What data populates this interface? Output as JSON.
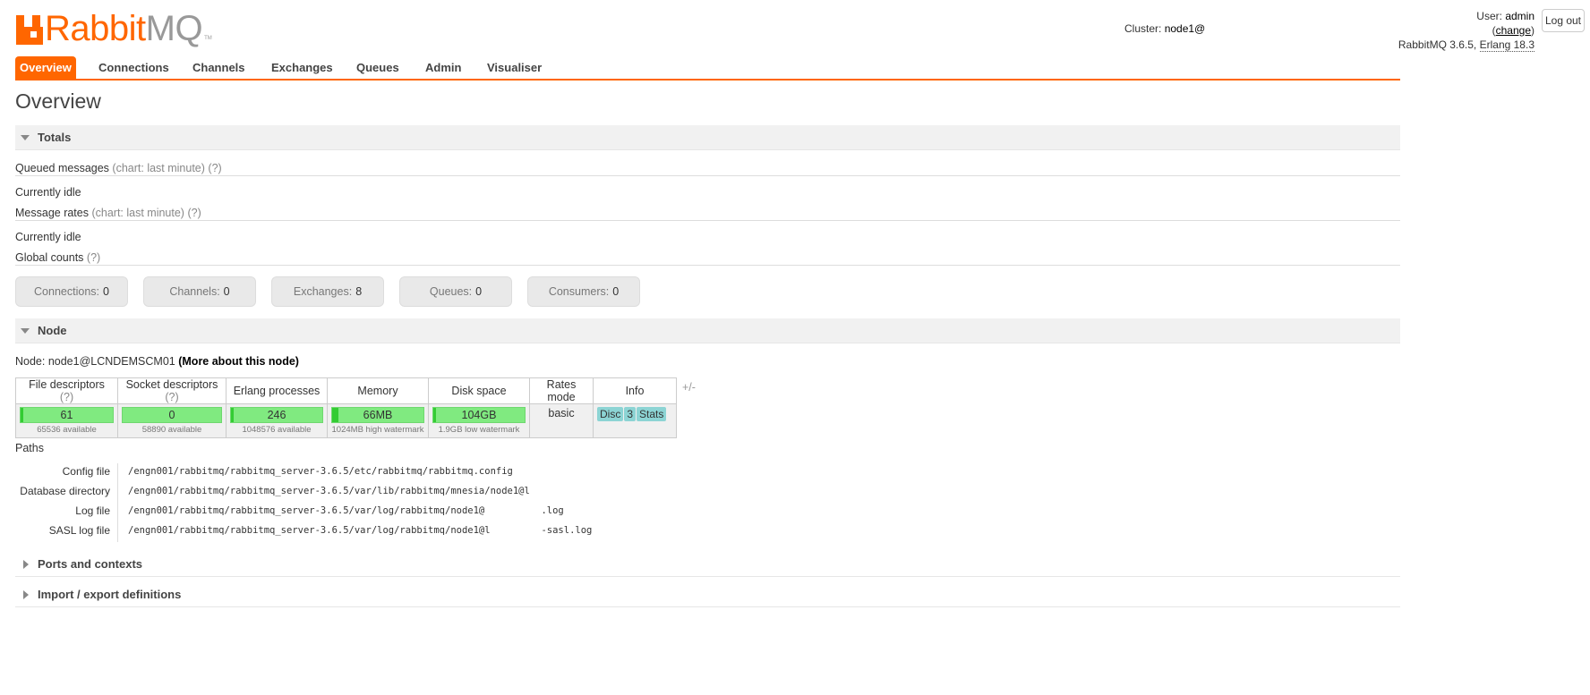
{
  "header": {
    "logo_rabbit": "Rabbit",
    "logo_mq": "MQ",
    "logo_tm": "TM",
    "cluster_label": "Cluster:",
    "cluster_value": "node1@",
    "user_label": "User:",
    "user_value": "admin",
    "change_open": "(",
    "change_link": "change",
    "change_close": ")",
    "version": "RabbitMQ 3.6.5,",
    "erlang": "Erlang 18.3",
    "logout": "Log out"
  },
  "tabs": [
    "Overview",
    "Connections",
    "Channels",
    "Exchanges",
    "Queues",
    "Admin",
    "Visualiser"
  ],
  "page_title": "Overview",
  "totals": {
    "header": "Totals",
    "queued_label": "Queued messages",
    "queued_chart": "(chart: last minute)",
    "help": "(?)",
    "queued_status": "Currently idle",
    "rates_label": "Message rates",
    "rates_chart": "(chart: last minute)",
    "rates_status": "Currently idle",
    "global_label": "Global counts",
    "counts": [
      {
        "label": "Connections:",
        "value": "0"
      },
      {
        "label": "Channels:",
        "value": "0"
      },
      {
        "label": "Exchanges:",
        "value": "8"
      },
      {
        "label": "Queues:",
        "value": "0"
      },
      {
        "label": "Consumers:",
        "value": "0"
      }
    ]
  },
  "node": {
    "header": "Node",
    "node_label": "Node: node1@LCNDEMSCM01",
    "more_link": "(More about this node)",
    "columns": {
      "fd": "File descriptors",
      "sd": "Socket descriptors",
      "ep": "Erlang processes",
      "mem": "Memory",
      "disk": "Disk space",
      "rates": "Rates mode",
      "info": "Info"
    },
    "help": "(?)",
    "fd_value": "61",
    "fd_sub": "65536 available",
    "fd_fraction": 0.001,
    "sd_value": "0",
    "sd_sub": "58890 available",
    "sd_fraction": 0,
    "ep_value": "246",
    "ep_sub": "1048576 available",
    "ep_fraction": 0.0002,
    "mem_value": "66MB",
    "mem_sub": "1024MB high watermark",
    "mem_fraction": 0.064,
    "disk_value": "104GB",
    "disk_sub": "1.9GB low watermark",
    "disk_fraction": 0.02,
    "rates_value": "basic",
    "info_pills": [
      "Disc",
      "3",
      "Stats"
    ],
    "plus_minus": "+/-"
  },
  "paths": {
    "header": "Paths",
    "rows": [
      {
        "key": "Config file",
        "value": "/engn001/rabbitmq/rabbitmq_server-3.6.5/etc/rabbitmq/rabbitmq.config"
      },
      {
        "key": "Database directory",
        "value": "/engn001/rabbitmq/rabbitmq_server-3.6.5/var/lib/rabbitmq/mnesia/node1@l"
      },
      {
        "key": "Log file",
        "value": "/engn001/rabbitmq/rabbitmq_server-3.6.5/var/log/rabbitmq/node1@          .log"
      },
      {
        "key": "SASL log file",
        "value": "/engn001/rabbitmq/rabbitmq_server-3.6.5/var/log/rabbitmq/node1@l         -sasl.log"
      }
    ]
  },
  "collapsed_sections": [
    "Ports and contexts",
    "Import / export definitions"
  ],
  "colors": {
    "accent": "#ff6600",
    "bar_green": "#80ea80",
    "pill": "#8cd4d4"
  }
}
